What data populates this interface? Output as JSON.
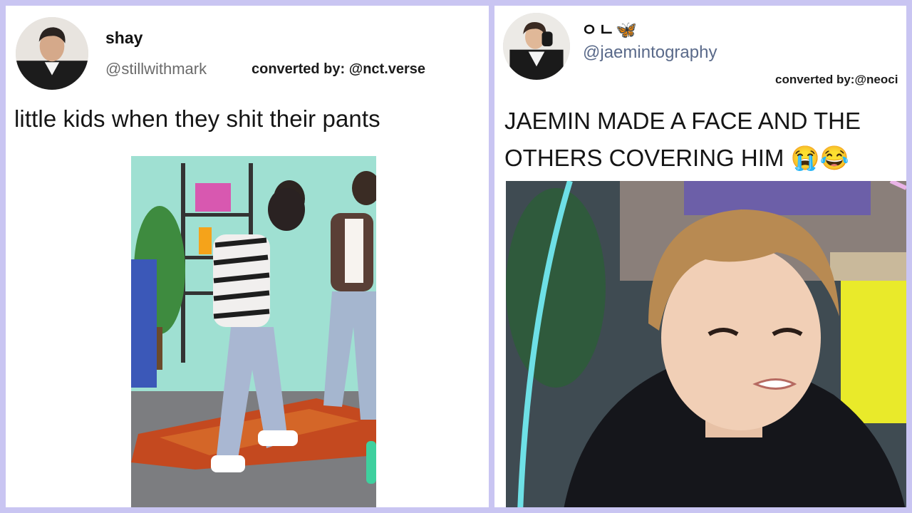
{
  "posts": [
    {
      "display_name": "shay",
      "handle": "@stillwithmark",
      "converted": "converted by: @nct.verse",
      "text": "little kids when they shit their pants"
    },
    {
      "display_name": "ㅇㄴ🦋",
      "handle": "@jaemintography",
      "converted": "converted by:@neoci",
      "text": "JAEMIN MADE A FACE AND THE OTHERS COVERING HIM 😭😂"
    }
  ],
  "colors": {
    "background": "#c9c5f2",
    "card": "#ffffff",
    "handle_left": "#6b6b6b",
    "handle_right": "#5a6a8a"
  }
}
